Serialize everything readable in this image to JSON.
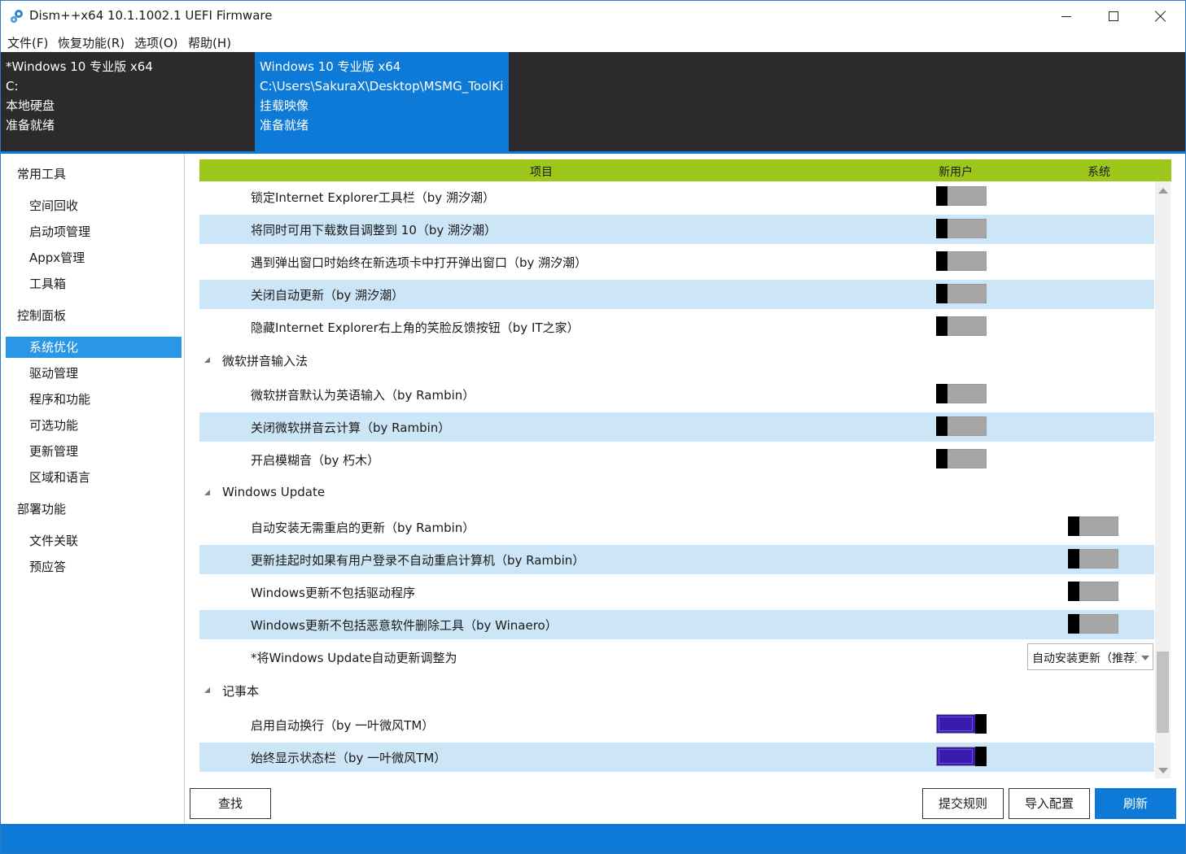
{
  "window": {
    "title": "Dism++x64 10.1.1002.1 UEFI Firmware",
    "accent_color": "#0c7ad6"
  },
  "menu": [
    "文件(F)",
    "恢复功能(R)",
    "选项(O)",
    "帮助(H)"
  ],
  "images": [
    {
      "name": "*Windows 10 专业版 x64",
      "path": "C:",
      "type": "本地硬盘",
      "status": "准备就绪",
      "selected": false
    },
    {
      "name": "Windows 10 专业版 x64",
      "path": "C:\\Users\\SakuraX\\Desktop\\MSMG_ToolKi",
      "type": "挂载映像",
      "status": "准备就绪",
      "selected": true
    }
  ],
  "sidebar": [
    {
      "label": "常用工具",
      "kind": "group"
    },
    {
      "label": "空间回收",
      "kind": "child"
    },
    {
      "label": "启动项管理",
      "kind": "child"
    },
    {
      "label": "Appx管理",
      "kind": "child"
    },
    {
      "label": "工具箱",
      "kind": "child"
    },
    {
      "label": "控制面板",
      "kind": "group"
    },
    {
      "label": "系统优化",
      "kind": "child",
      "active": true
    },
    {
      "label": "驱动管理",
      "kind": "child"
    },
    {
      "label": "程序和功能",
      "kind": "child"
    },
    {
      "label": "可选功能",
      "kind": "child"
    },
    {
      "label": "更新管理",
      "kind": "child"
    },
    {
      "label": "区域和语言",
      "kind": "child"
    },
    {
      "label": "部署功能",
      "kind": "group"
    },
    {
      "label": "文件关联",
      "kind": "child"
    },
    {
      "label": "预应答",
      "kind": "child"
    }
  ],
  "table": {
    "header_color": "#9ec71c",
    "columns": {
      "item": "项目",
      "new_user": "新用户",
      "system": "系统"
    }
  },
  "rows": [
    {
      "type": "item",
      "label": "锁定Internet Explorer工具栏（by 溯汐潮）",
      "column": "user",
      "on": false
    },
    {
      "type": "item",
      "label": "将同时可用下载数目调整到 10（by 溯汐潮）",
      "column": "user",
      "on": false
    },
    {
      "type": "item",
      "label": "遇到弹出窗口时始终在新选项卡中打开弹出窗口（by 溯汐潮）",
      "column": "user",
      "on": false
    },
    {
      "type": "item",
      "label": "关闭自动更新（by 溯汐潮）",
      "column": "user",
      "on": false
    },
    {
      "type": "item",
      "label": "隐藏Internet Explorer右上角的笑脸反馈按钮（by IT之家）",
      "column": "user",
      "on": false
    },
    {
      "type": "group",
      "label": "微软拼音输入法"
    },
    {
      "type": "item",
      "label": "微软拼音默认为英语输入（by Rambin）",
      "column": "user",
      "on": false
    },
    {
      "type": "item",
      "label": "关闭微软拼音云计算（by Rambin）",
      "column": "user",
      "on": false
    },
    {
      "type": "item",
      "label": "开启模糊音（by 朽木）",
      "column": "user",
      "on": false
    },
    {
      "type": "group",
      "label": "Windows Update"
    },
    {
      "type": "item",
      "label": "自动安装无需重启的更新（by Rambin）",
      "column": "sys",
      "on": false
    },
    {
      "type": "item",
      "label": "更新挂起时如果有用户登录不自动重启计算机（by Rambin）",
      "column": "sys",
      "on": false
    },
    {
      "type": "item",
      "label": "Windows更新不包括驱动程序",
      "column": "sys",
      "on": false
    },
    {
      "type": "item",
      "label": "Windows更新不包括恶意软件删除工具（by Winaero）",
      "column": "sys",
      "on": false
    },
    {
      "type": "select",
      "label": "*将Windows Update自动更新调整为",
      "value": "自动安装更新（推荐）"
    },
    {
      "type": "group",
      "label": "记事本"
    },
    {
      "type": "item",
      "label": "启用自动换行（by 一叶微风TM）",
      "column": "user",
      "on": true
    },
    {
      "type": "item",
      "label": "始终显示状态栏（by 一叶微风TM）",
      "column": "user",
      "on": true
    }
  ],
  "buttons": {
    "find": "查找",
    "submit": "提交规则",
    "import": "导入配置",
    "refresh": "刷新"
  }
}
